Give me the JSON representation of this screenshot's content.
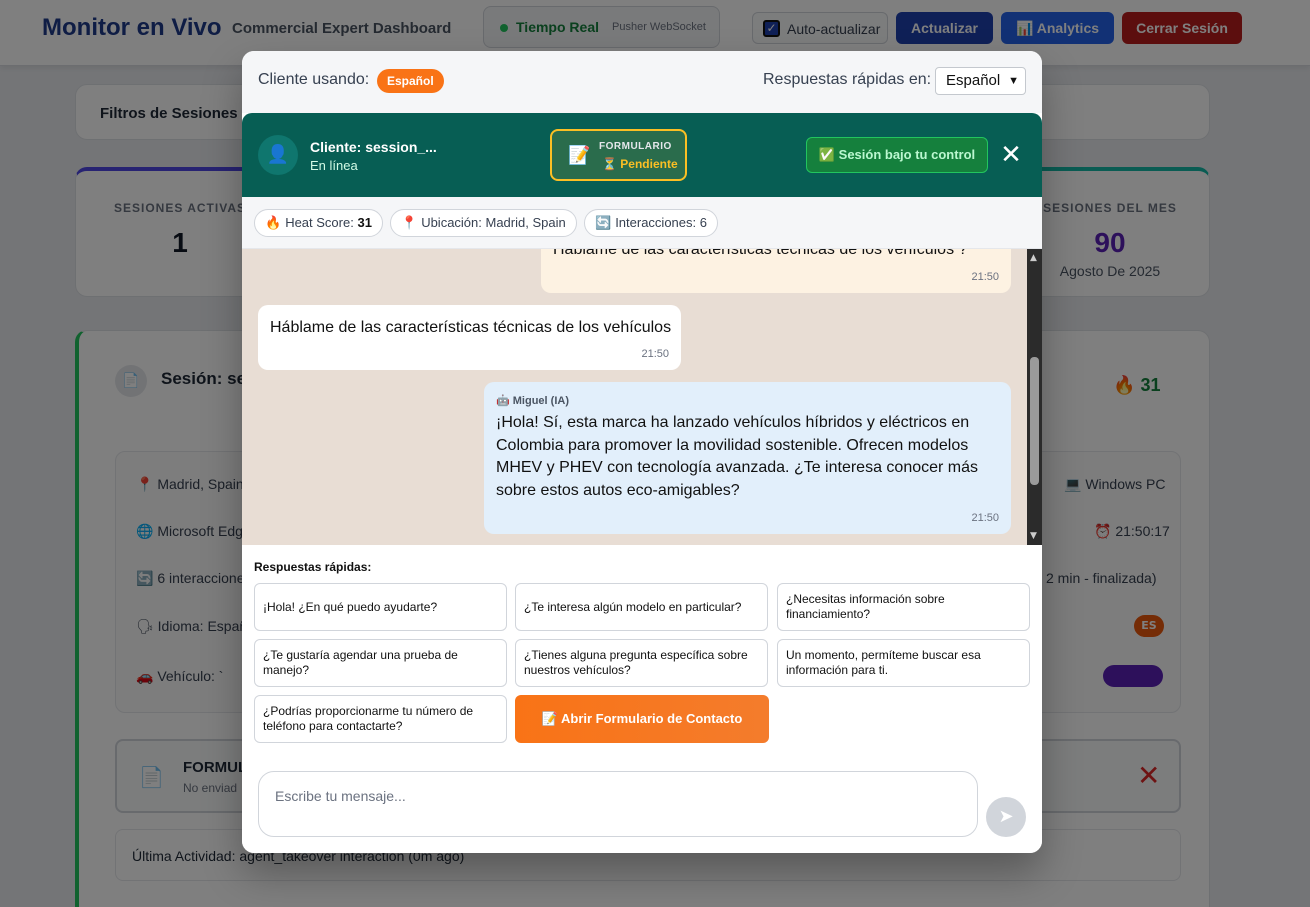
{
  "header": {
    "title": "Monitor en Vivo",
    "subtitle": "Commercial Expert Dashboard",
    "realtime_label": "Tiempo Real",
    "realtime_sub": "Pusher WebSocket",
    "auto_update_label": "Auto-actualizar",
    "auto_update_checked": true,
    "update_label": "Actualizar",
    "analytics_label": "📊 Analytics",
    "logout_label": "Cerrar Sesión"
  },
  "filters": {
    "title": "Filtros de Sesiones"
  },
  "stats": {
    "active": {
      "label": "SESIONES ACTIVAS",
      "value": "1"
    },
    "month": {
      "label": "SESIONES DEL MES",
      "value": "90",
      "sub": "Agosto De 2025"
    }
  },
  "session_card": {
    "title": "Sesión: ses",
    "heat": "31",
    "location": "📍 Madrid, Spain",
    "browser": "🌐 Microsoft Edge",
    "interactions": "🔄 6 interacciones",
    "language": "🗣 Idioma: Españ",
    "vehicle": "🚗 Vehículo: `",
    "os": "💻 Windows PC",
    "time": "⏰ 21:50:17",
    "duration": "2 min - finalizada)",
    "lang_badge": "ES",
    "form_title": "FORMUL",
    "form_sub": "No enviad",
    "last_activity": "Última Actividad: agent_takeover interaction (0m ago)"
  },
  "modal": {
    "client_language_label": "Cliente usando:",
    "client_language": "Español",
    "quick_language_label": "Respuestas rápidas en:",
    "quick_language_value": "Español",
    "client_name": "Cliente: session_...",
    "client_status": "En línea",
    "form_status_title": "FORMULARIO",
    "form_status_value": "⏳ Pendiente",
    "control_label": "✅ Sesión bajo tu control",
    "chips": {
      "heat_label": "Heat Score:",
      "heat_value": "31",
      "location": "Ubicación: Madrid, Spain",
      "interactions": "Interacciones: 6"
    },
    "messages": [
      {
        "text": "Háblame de las características técnicas de los vehículos ?",
        "time": "21:50"
      },
      {
        "text": "Háblame de las características técnicas de los vehículos",
        "time": "21:50"
      },
      {
        "author": "Miguel (IA)",
        "text": "¡Hola! Sí, esta marca ha lanzado vehículos híbridos y eléctricos en Colombia para promover la movilidad sostenible. Ofrecen modelos MHEV y PHEV con tecnología avanzada. ¿Te interesa conocer más sobre estos autos eco-amigables?",
        "time": "21:50"
      }
    ],
    "quick_title": "Respuestas rápidas:",
    "quick_replies": [
      "¡Hola! ¿En qué puedo ayudarte?",
      "¿Te interesa algún modelo en particular?",
      "¿Necesitas información sobre financiamiento?",
      "¿Te gustaría agendar una prueba de manejo?",
      "¿Tienes alguna pregunta específica sobre nuestros vehículos?",
      "Un momento, permíteme buscar esa información para ti.",
      "¿Podrías proporcionarme tu número de teléfono para contactarte?"
    ],
    "open_form_label": "📝 Abrir Formulario de Contacto",
    "input_placeholder": "Escribe tu mensaje..."
  }
}
